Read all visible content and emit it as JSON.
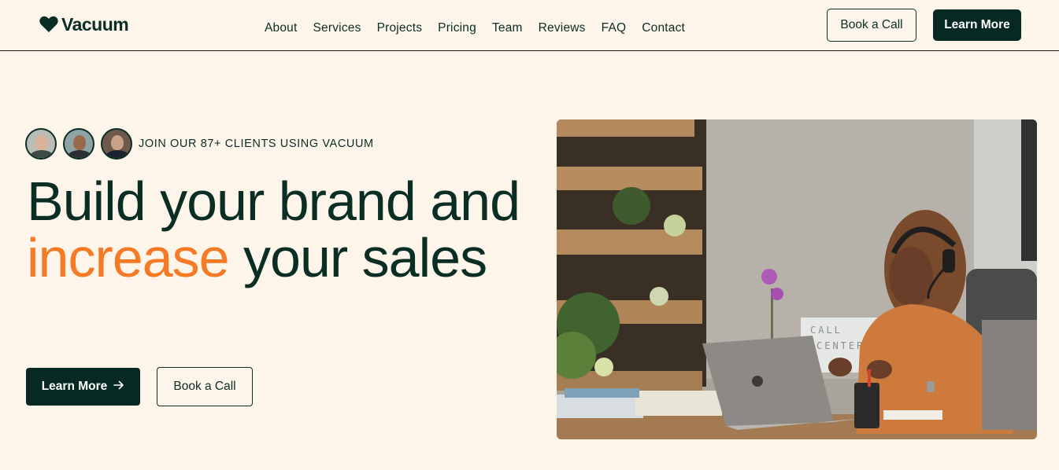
{
  "brand": {
    "name": "Vacuum",
    "logo_icon": "heart-icon"
  },
  "nav": {
    "items": [
      {
        "label": "About"
      },
      {
        "label": "Services"
      },
      {
        "label": "Projects"
      },
      {
        "label": "Pricing"
      },
      {
        "label": "Team"
      },
      {
        "label": "Reviews"
      },
      {
        "label": "FAQ"
      },
      {
        "label": "Contact"
      }
    ]
  },
  "header_actions": {
    "book_call_label": "Book a Call",
    "learn_more_label": "Learn More"
  },
  "hero": {
    "clients_prefix": "JOIN OUR 87+ CLIENTS USING",
    "clients_brand": "VACUUM",
    "headline_part1": "Build your brand and",
    "headline_accent": "increase",
    "headline_part2": "your sales",
    "primary_cta": "Learn More",
    "primary_cta_icon": "arrow-right-icon",
    "secondary_cta": "Book a Call",
    "photo_sign_text": "CALL CENTER"
  },
  "colors": {
    "background": "#fdf4ea",
    "primary_dark": "#062a22",
    "accent_orange": "#f47a25",
    "text": "#0b2e24"
  }
}
